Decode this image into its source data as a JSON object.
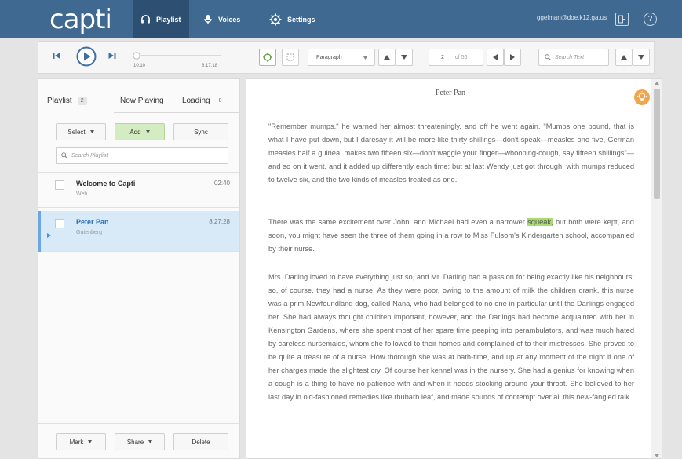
{
  "app": {
    "logo": "capti",
    "nav": [
      {
        "label": "Playlist"
      },
      {
        "label": "Voices"
      },
      {
        "label": "Settings"
      }
    ],
    "user_email": "ggelman@doe.k12.ga.us",
    "help_icon_text": "?"
  },
  "player": {
    "current_time": "10:10",
    "total_time": "8:17:18",
    "progress_fraction": 0.02,
    "unit_select": "Paragraph",
    "page_value": "2",
    "page_of": "of 56",
    "search_placeholder": "Search Text"
  },
  "sidebar": {
    "tabs": [
      {
        "label": "Playlist",
        "count": "2"
      },
      {
        "label": "Now Playing",
        "count": ""
      },
      {
        "label": "Loading",
        "count": "0"
      }
    ],
    "buttons": {
      "select": "Select",
      "add": "Add",
      "sync": "Sync"
    },
    "search_placeholder": "Search Playlist",
    "items": [
      {
        "title": "Welcome to Capti",
        "source": "Web",
        "duration": "02:40"
      },
      {
        "title": "Peter Pan",
        "source": "Gutenberg",
        "duration": "8:27:28"
      }
    ],
    "footer": {
      "mark": "Mark",
      "share": "Share",
      "delete": "Delete"
    }
  },
  "reader": {
    "title": "Peter Pan",
    "para1": "\"Remember mumps,\" he warned her almost threateningly, and off he went again. \"Mumps one pound, that is what I have put down, but I daresay it will be more like thirty shillings—don't speak—measles one five, German measles half a guinea, makes two fifteen six—don't waggle your finger—whooping-cough, say fifteen shillings\"—and so on it went, and it added up differently each time; but at last Wendy just got through, with mumps reduced to twelve six, and the two kinds of measles treated as one.",
    "para2_before": "There was the same excitement over John, and Michael had even a narrower ",
    "para2_highlight": "squeak,",
    "para2_after": " but both were kept, and soon, you might have seen the three of them going in a row to Miss Fulsom's Kindergarten school, accompanied by their nurse.",
    "para3": "Mrs. Darling loved to have everything just so, and Mr. Darling had a passion for being exactly like his neighbours; so, of course, they had a nurse. As they were poor, owing to the amount of milk the children drank, this nurse was a prim Newfoundland dog, called Nana, who had belonged to no one in particular until the Darlings engaged her. She had always thought children important, however, and the Darlings had become acquainted with her in Kensington Gardens, where she spent most of her spare time peeping into perambulators, and was much hated by careless nursemaids, whom she followed to their homes and complained of to their mistresses. She proved to be quite a treasure of a nurse. How thorough she was at bath-time, and up at any moment of the night if one of her charges made the slightest cry. Of course her kennel was in the nursery. She had a genius for knowing when a cough is a thing to have no patience with and when it needs stocking around your throat. She believed to her last day in old-fashioned remedies like rhubarb leaf, and made sounds of contempt over all this new-fangled talk"
  },
  "colors": {
    "navbar": "#3f6990",
    "navbar_active": "#2c4f72",
    "highlight": "#a9dc6e",
    "add_button": "#d4ecc1",
    "selected_item": "#d8e9f8",
    "link_blue": "#2a6db3"
  }
}
